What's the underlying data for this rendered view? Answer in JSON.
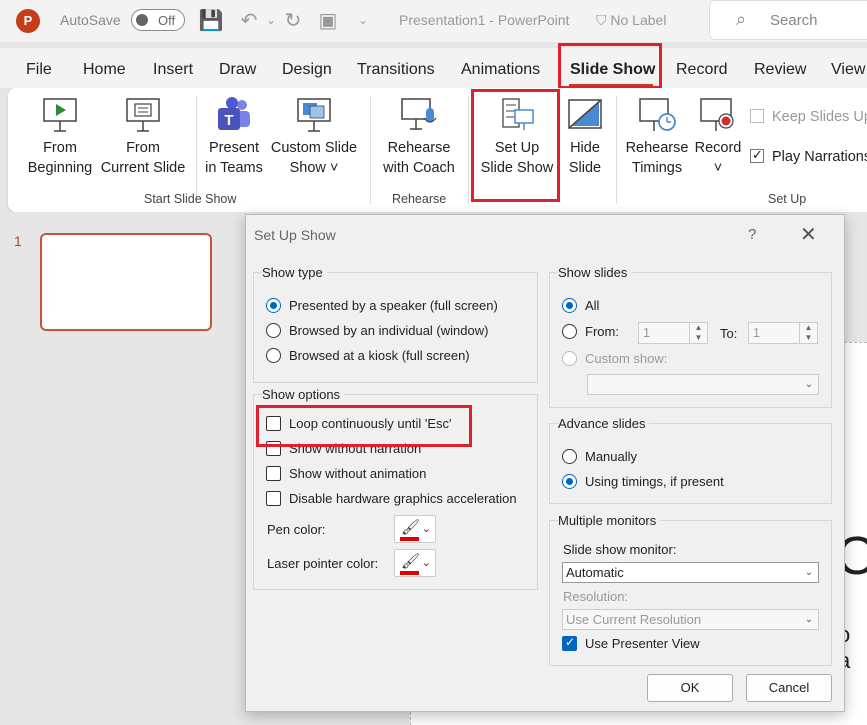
{
  "titlebar": {
    "app_letter": "P",
    "autosave_label": "AutoSave",
    "autosave_state": "Off",
    "doc_title": "Presentation1 - PowerPoint",
    "sensitivity_label": "No Label",
    "search_placeholder": "Search"
  },
  "tabs": [
    "File",
    "Home",
    "Insert",
    "Draw",
    "Design",
    "Transitions",
    "Animations",
    "Slide Show",
    "Record",
    "Review",
    "View"
  ],
  "active_tab": "Slide Show",
  "ribbon": {
    "from_beginning": [
      "From",
      "Beginning"
    ],
    "from_current": [
      "From",
      "Current Slide"
    ],
    "present_teams": [
      "Present",
      "in Teams"
    ],
    "custom_show": [
      "Custom Slide",
      "Show ˅"
    ],
    "group_start": "Start Slide Show",
    "rehearse_coach": [
      "Rehearse",
      "with Coach"
    ],
    "group_rehearse": "Rehearse",
    "setup_show": [
      "Set Up",
      "Slide Show"
    ],
    "hide_slide": [
      "Hide",
      "Slide"
    ],
    "rehearse_timings": [
      "Rehearse",
      "Timings"
    ],
    "record": [
      "Record",
      "˅"
    ],
    "keep_slides": "Keep Slides Up",
    "play_narrations": "Play Narrations",
    "group_setup": "Set Up"
  },
  "thumbs": {
    "slide_number": "1"
  },
  "background_text": {
    "big": "O",
    "small": "o a"
  },
  "dialog": {
    "title": "Set Up Show",
    "help": "?",
    "show_type": {
      "legend": "Show type",
      "options": [
        "Presented by a speaker (full screen)",
        "Browsed by an individual (window)",
        "Browsed at a kiosk (full screen)"
      ],
      "selected_index": 0
    },
    "show_options": {
      "legend": "Show options",
      "loop": "Loop continuously until 'Esc'",
      "no_narration": "Show without narration",
      "no_animation": "Show without animation",
      "disable_hw": "Disable hardware graphics acceleration",
      "pen_color_label": "Pen color:",
      "laser_color_label": "Laser pointer color:",
      "pen_color": "#e00000",
      "laser_color": "#e00000"
    },
    "show_slides": {
      "legend": "Show slides",
      "all": "All",
      "from": "From:",
      "from_value": "1",
      "to": "To:",
      "to_value": "1",
      "custom_show": "Custom show:"
    },
    "advance_slides": {
      "legend": "Advance slides",
      "manually": "Manually",
      "timings": "Using timings, if present",
      "selected": "timings"
    },
    "monitors": {
      "legend": "Multiple monitors",
      "monitor_label": "Slide show monitor:",
      "monitor_value": "Automatic",
      "resolution_label": "Resolution:",
      "resolution_value": "Use Current Resolution",
      "presenter_view": "Use Presenter View"
    },
    "ok": "OK",
    "cancel": "Cancel"
  },
  "colors": {
    "accent": "#c43e1c",
    "highlight": "#e0202e",
    "selection": "#0067c0"
  }
}
